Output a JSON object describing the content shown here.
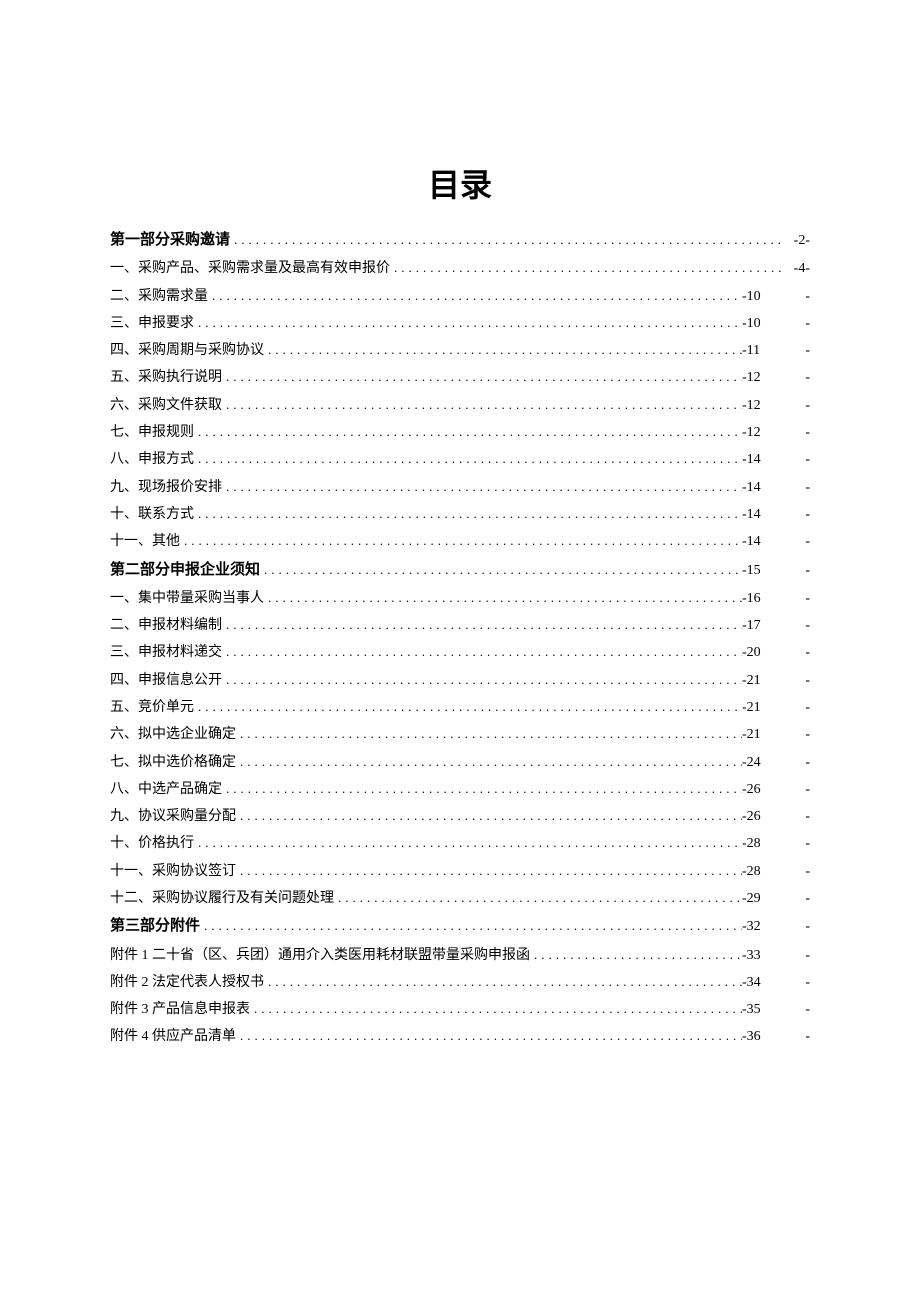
{
  "title": "目录",
  "entries": [
    {
      "label": "第一部分采购邀请",
      "page": "-2-",
      "bold": true,
      "wide": false
    },
    {
      "label": "一、采购产品、采购需求量及最高有效申报价",
      "page": "-4-",
      "bold": false,
      "wide": false
    },
    {
      "label": "二、采购需求量",
      "page": "-10",
      "suffix": "-",
      "bold": false,
      "wide": true
    },
    {
      "label": "三、申报要求",
      "page": "-10",
      "suffix": "-",
      "bold": false,
      "wide": true
    },
    {
      "label": "四、采购周期与采购协议",
      "page": "-11",
      "suffix": "-",
      "bold": false,
      "wide": true
    },
    {
      "label": "五、采购执行说明",
      "page": "-12",
      "suffix": "-",
      "bold": false,
      "wide": true
    },
    {
      "label": "六、采购文件获取",
      "page": "-12",
      "suffix": "-",
      "bold": false,
      "wide": true
    },
    {
      "label": "七、申报规则",
      "page": "-12",
      "suffix": "-",
      "bold": false,
      "wide": true
    },
    {
      "label": "八、申报方式",
      "page": "-14",
      "suffix": "-",
      "bold": false,
      "wide": true
    },
    {
      "label": "九、现场报价安排",
      "page": "-14",
      "suffix": "-",
      "bold": false,
      "wide": true
    },
    {
      "label": "十、联系方式",
      "page": "-14",
      "suffix": "-",
      "bold": false,
      "wide": true
    },
    {
      "label": "十一、其他",
      "page": "-14",
      "suffix": "-",
      "bold": false,
      "wide": true
    },
    {
      "label": "第二部分申报企业须知",
      "page": "-15",
      "suffix": "-",
      "bold": true,
      "wide": true
    },
    {
      "label": "一、集中带量采购当事人",
      "page": "-16",
      "suffix": "-",
      "bold": false,
      "wide": true
    },
    {
      "label": "二、申报材料编制",
      "page": "-17",
      "suffix": "-",
      "bold": false,
      "wide": true
    },
    {
      "label": "三、申报材料递交",
      "page": "-20",
      "suffix": "-",
      "bold": false,
      "wide": true
    },
    {
      "label": "四、申报信息公开",
      "page": "-21",
      "suffix": "-",
      "bold": false,
      "wide": true
    },
    {
      "label": "五、竞价单元",
      "page": "-21",
      "suffix": "-",
      "bold": false,
      "wide": true
    },
    {
      "label": "六、拟中选企业确定",
      "page": "-21",
      "suffix": "-",
      "bold": false,
      "wide": true
    },
    {
      "label": "七、拟中选价格确定",
      "page": "-24",
      "suffix": "-",
      "bold": false,
      "wide": true
    },
    {
      "label": "八、中选产品确定",
      "page": "-26",
      "suffix": "-",
      "bold": false,
      "wide": true
    },
    {
      "label": "九、协议采购量分配",
      "page": "-26",
      "suffix": "-",
      "bold": false,
      "wide": true
    },
    {
      "label": "十、价格执行",
      "page": "-28",
      "suffix": "-",
      "bold": false,
      "wide": true
    },
    {
      "label": "十一、采购协议签订",
      "page": "-28",
      "suffix": "-",
      "bold": false,
      "wide": true
    },
    {
      "label": "十二、采购协议履行及有关问题处理",
      "page": "-29",
      "suffix": "-",
      "bold": false,
      "wide": true
    },
    {
      "label": "第三部分附件",
      "page": "-32",
      "suffix": "-",
      "bold": true,
      "wide": true
    },
    {
      "label": "附件 1 二十省（区、兵团）通用介入类医用耗材联盟带量采购申报函",
      "page": "-33",
      "suffix": "-",
      "bold": false,
      "wide": true
    },
    {
      "label": "附件 2 法定代表人授权书",
      "page": "-34",
      "suffix": "-",
      "bold": false,
      "wide": true
    },
    {
      "label": "附件 3 产品信息申报表",
      "page": "-35",
      "suffix": "-",
      "bold": false,
      "wide": true
    },
    {
      "label": "附件 4 供应产品清单",
      "page": "-36",
      "suffix": "-",
      "bold": false,
      "wide": true
    }
  ]
}
